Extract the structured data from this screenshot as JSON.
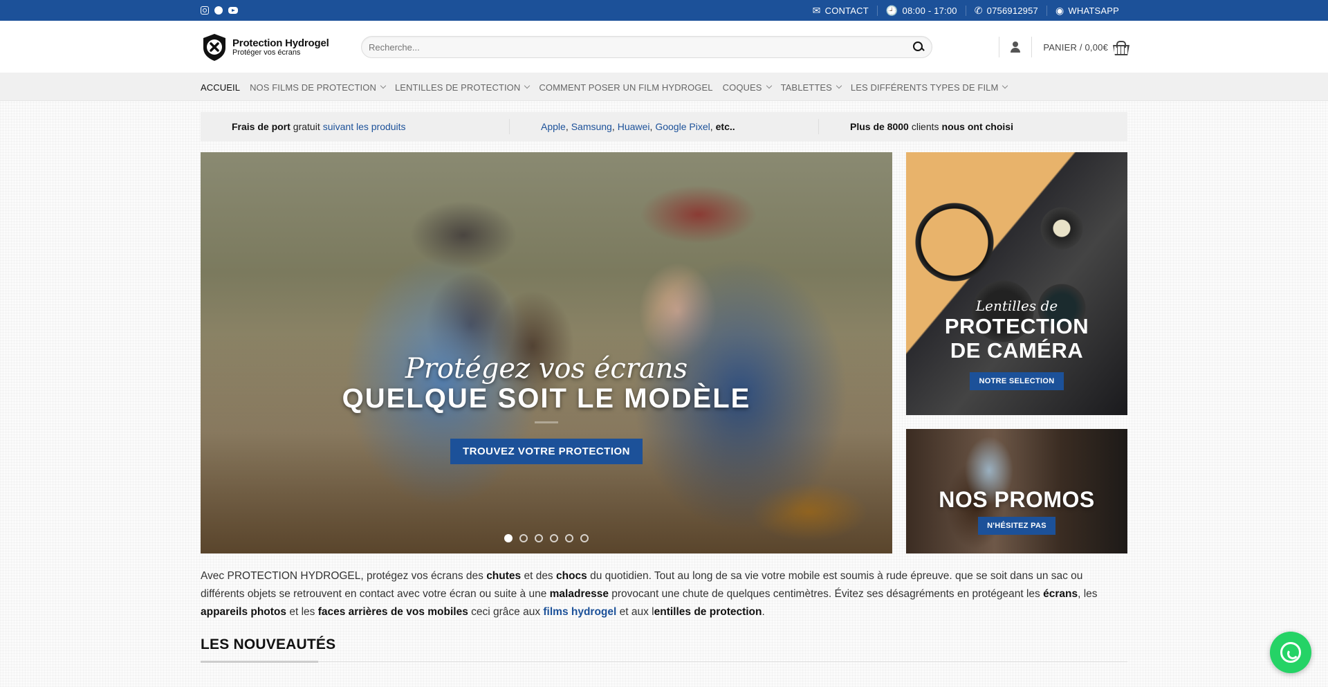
{
  "topbar": {
    "social": [
      "instagram-icon",
      "pinterest-icon",
      "youtube-icon"
    ],
    "links": [
      {
        "icon": "mail-icon",
        "glyph": "✉",
        "label": "CONTACT"
      },
      {
        "icon": "clock-icon",
        "glyph": "🕘",
        "label": "08:00 - 17:00"
      },
      {
        "icon": "phone-icon",
        "glyph": "✆",
        "label": "0756912957"
      },
      {
        "icon": "whatsapp-icon",
        "glyph": "◉",
        "label": "WHATSAPP"
      }
    ]
  },
  "header": {
    "logo_title": "Protection Hydrogel",
    "logo_subtitle": "Protéger vos écrans",
    "search_placeholder": "Recherche...",
    "cart_label": "PANIER / 0,00€"
  },
  "nav": [
    {
      "label": "ACCUEIL",
      "dropdown": false,
      "active": true
    },
    {
      "label": "NOS FILMS DE PROTECTION",
      "dropdown": true
    },
    {
      "label": "LENTILLES DE PROTECTION",
      "dropdown": true
    },
    {
      "label": "COMMENT POSER UN FILM HYDROGEL",
      "dropdown": false
    },
    {
      "label": "COQUES",
      "dropdown": true
    },
    {
      "label": "TABLETTES",
      "dropdown": true
    },
    {
      "label": "LES DIFFÉRENTS TYPES DE FILM",
      "dropdown": true
    }
  ],
  "info": {
    "c1_b": "Frais de port",
    "c1_t": "gratuit",
    "c1_l": "suivant les produits",
    "c2_links": [
      "Apple",
      "Samsung",
      "Huawei",
      "Google Pixel"
    ],
    "c2_sep": ", ",
    "c2_end": "etc..",
    "c3_b1": "Plus de 8000",
    "c3_t": "clients",
    "c3_b2": "nous ont choisi"
  },
  "slider": {
    "script": "Protégez vos écrans",
    "title": "QUELQUE SOIT LE MODÈLE",
    "button": "TROUVEZ VOTRE PROTECTION",
    "slide_count": 6,
    "active": 0
  },
  "banner1": {
    "script": "Lentilles de",
    "title1": "PROTECTION",
    "title2": "DE CAMÉRA",
    "button": "NOTRE SELECTION"
  },
  "banner2": {
    "title": "NOS PROMOS",
    "button": "N'HÉSITEZ PAS"
  },
  "intro": {
    "p1": "Avec PROTECTION HYDROGEL, protégez vos écrans des ",
    "b1": "chutes",
    "p2": " et des ",
    "b2": "chocs",
    "p3": " du quotidien. Tout au long de sa vie votre mobile est soumis à rude épreuve. que se soit dans un sac ou différents objets se retrouvent en contact avec votre écran ou suite à une ",
    "b3": "maladresse",
    "p4": " provocant une chute de quelques centimètres. Évitez ses désagréments en protégeant les ",
    "b4": "écrans",
    "p5": ", les ",
    "b5": "appareils photos",
    "p6": " et les ",
    "b6": "faces arrières de vos mobiles",
    "p7": " ceci grâce aux ",
    "l1": "films hydrogel",
    "p8": " et aux l",
    "b7": "entilles de protection",
    "p9": "."
  },
  "section_title": "LES NOUVEAUTÉS"
}
